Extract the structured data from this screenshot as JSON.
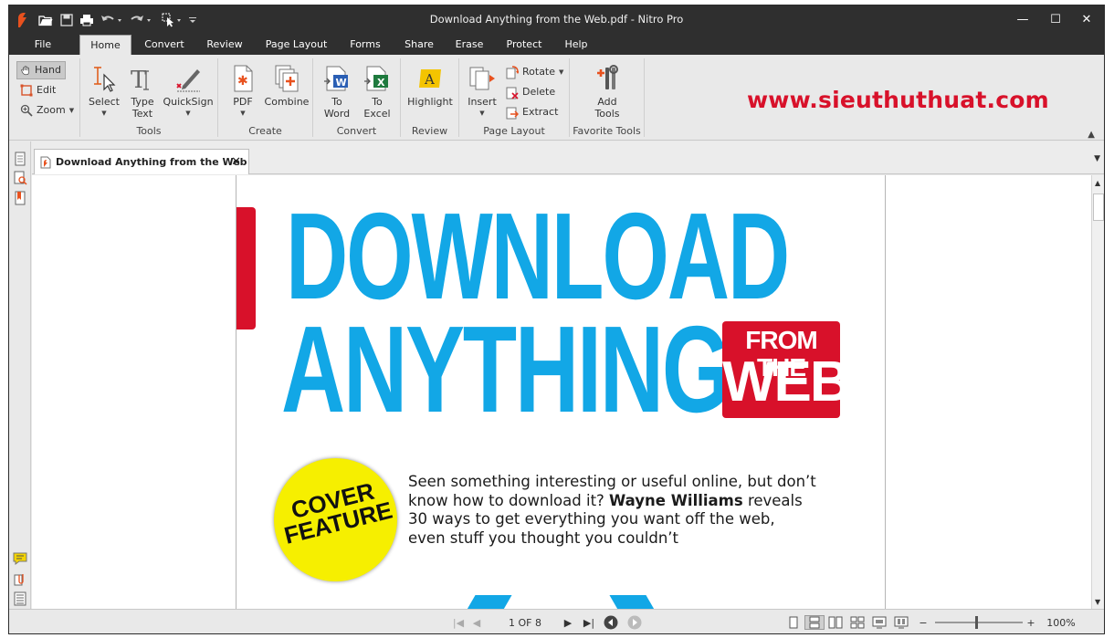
{
  "window": {
    "title": "Download Anything from the Web.pdf - Nitro Pro",
    "controls": {
      "minimize": "—",
      "maximize": "☐",
      "close": "✕"
    }
  },
  "menu_tabs": [
    "File",
    "Home",
    "Convert",
    "Review",
    "Page Layout",
    "Forms",
    "Share",
    "Erase",
    "Protect",
    "Help"
  ],
  "active_tab": "Home",
  "ribbon": {
    "nav": {
      "hand": "Hand",
      "edit": "Edit",
      "zoom": "Zoom"
    },
    "tools": {
      "select": "Select",
      "type_text_1": "Type",
      "type_text_2": "Text",
      "quicksign": "QuickSign",
      "label": "Tools"
    },
    "create": {
      "pdf": "PDF",
      "combine": "Combine",
      "label": "Create"
    },
    "convert": {
      "to_word_1": "To",
      "to_word_2": "Word",
      "to_excel_1": "To",
      "to_excel_2": "Excel",
      "label": "Convert"
    },
    "review": {
      "highlight": "Highlight",
      "label": "Review"
    },
    "page_layout": {
      "insert": "Insert",
      "rotate": "Rotate",
      "delete": "Delete",
      "extract": "Extract",
      "label": "Page Layout"
    },
    "favorite": {
      "add_tools_1": "Add",
      "add_tools_2": "Tools",
      "label": "Favorite Tools"
    }
  },
  "watermark": "www.sieuthuthuat.com",
  "document_tab": {
    "title": "Download Anything from the Web"
  },
  "document": {
    "headline_1": "DOWNLOAD",
    "headline_2": "ANYTHING",
    "badge_1": "FROM THE",
    "badge_2": "WEB",
    "cover_1": "COVER",
    "cover_2": "FEATURE",
    "intro_line_1": "Seen something interesting or useful online, but don’t",
    "intro_line_2_a": "know how to download it? ",
    "intro_author": "Wayne Williams",
    "intro_line_2_b": " reveals",
    "intro_line_3": "30 ways to get everything you want off the web,",
    "intro_line_4": "even stuff you thought you couldn’t"
  },
  "status": {
    "page_indicator": "1 OF 8",
    "zoom_minus": "−",
    "zoom_plus": "+",
    "zoom_level": "100%"
  },
  "colors": {
    "accent_blue": "#12a7e6",
    "brand_red": "#d8112a",
    "cover_yellow": "#f6ef00"
  }
}
